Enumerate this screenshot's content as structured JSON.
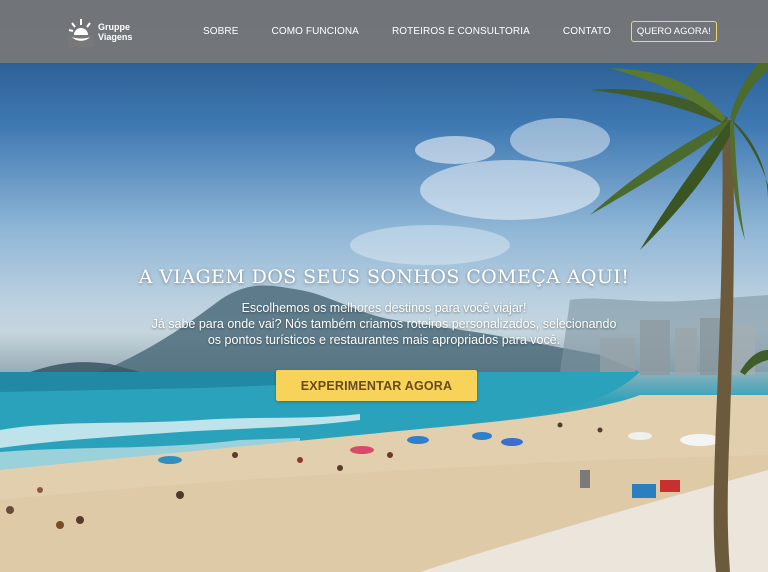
{
  "brand": {
    "line1": "Gruppe",
    "line2": "Viagens",
    "icon": "sun-logo-icon"
  },
  "nav": {
    "items": [
      "SOBRE",
      "COMO FUNCIONA",
      "ROTEIROS E CONSULTORIA",
      "CONTATO"
    ],
    "cta_label": "QUERO AGORA!"
  },
  "hero": {
    "headline": "A VIAGEM DOS SEUS SONHOS COMEÇA AQUI!",
    "subtitle_lines": [
      "Escolhemos os melhores destinos para você viajar!",
      "Já sabe para onde vai? Nós também criamos roteiros personalizados, selecionando",
      "os pontos turísticos e restaurantes mais apropriados para você."
    ],
    "cta_label": "EXPERIMENTAR AGORA"
  },
  "colors": {
    "accent": "#f7d35a",
    "header_bg": "#787878",
    "cta_text": "#6a4a1c"
  }
}
